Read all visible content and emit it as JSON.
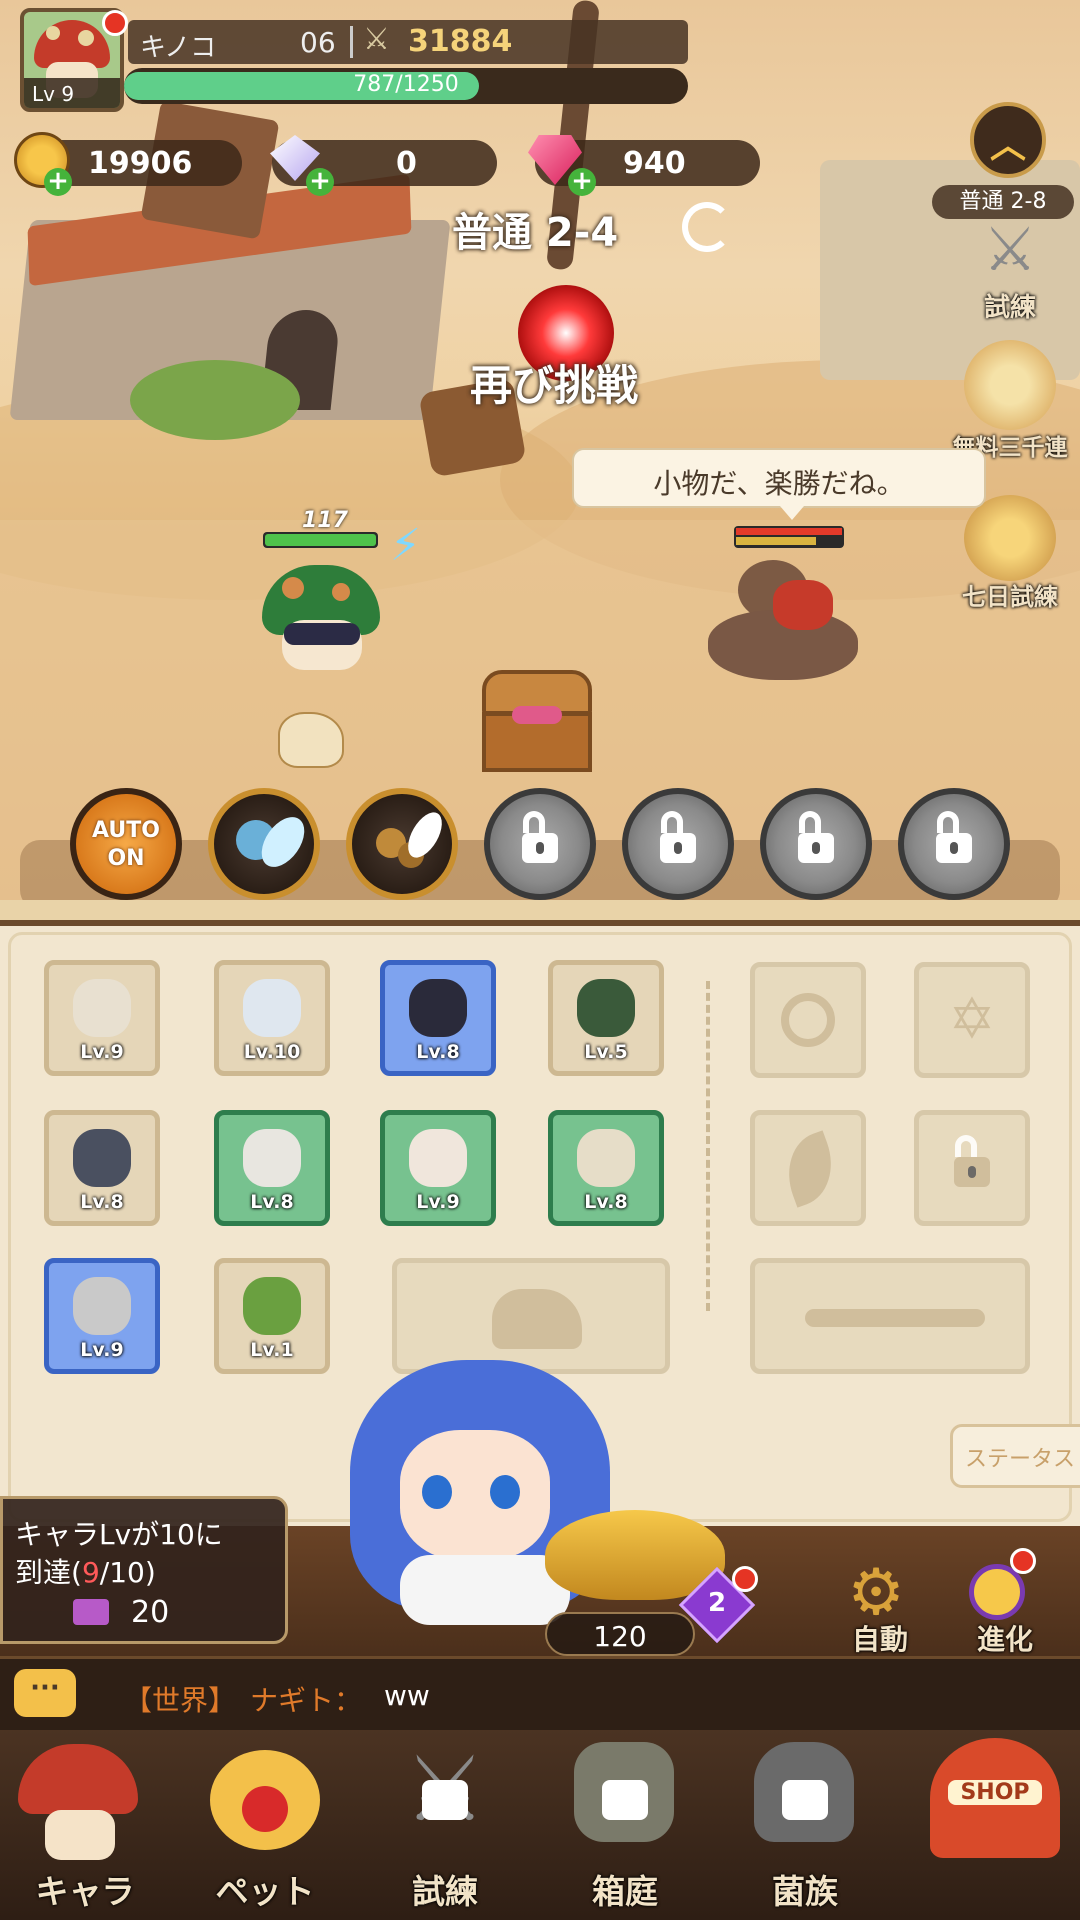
{
  "player": {
    "name": "キノコ",
    "id_suffix": "06",
    "level": "Lv 9",
    "power": "31884",
    "exp_text": "787/1250",
    "exp_progress": 0.63
  },
  "currencies": {
    "gold": "19906",
    "crystal": "0",
    "gem": "940"
  },
  "stage": {
    "label": "普通 2-4",
    "retry_label": "再び挑戦",
    "side_stage": "普通 2-8"
  },
  "side_menu": [
    {
      "label": "試練"
    },
    {
      "label": "無料三千連"
    },
    {
      "label": "七日試練"
    }
  ],
  "battle": {
    "player_hp": "117",
    "enemy_speech": "小物だ、楽勝だね。"
  },
  "skills": {
    "auto_line1": "AUTO",
    "auto_line2": "ON"
  },
  "equipment": [
    {
      "lv": "Lv.9",
      "item": "baseball"
    },
    {
      "lv": "Lv.10",
      "item": "gloves"
    },
    {
      "lv": "Lv.8",
      "item": "goggles"
    },
    {
      "lv": "Lv.5",
      "item": "helmet"
    },
    {
      "lv": "Lv.8",
      "item": "shirt"
    },
    {
      "lv": "Lv.8",
      "item": "boots"
    },
    {
      "lv": "Lv.9",
      "item": "gauntlet"
    },
    {
      "lv": "Lv.8",
      "item": "belt"
    },
    {
      "lv": "Lv.9",
      "item": "shield"
    },
    {
      "lv": "Lv.1",
      "item": "shoes"
    }
  ],
  "status_button": "ステータス",
  "quest": {
    "line1": "キャラLvが10に",
    "line2_prefix": "到達(",
    "line2_progress": "9",
    "line2_suffix": "/10)",
    "reward": "20"
  },
  "lamp": {
    "cost": "120",
    "badge": "2"
  },
  "actions": {
    "auto": "自動",
    "evolve": "進化"
  },
  "chat": {
    "channel": "【世界】",
    "sender": "ナギト：",
    "message": "ww"
  },
  "nav": [
    {
      "label": "キャラ"
    },
    {
      "label": "ペット"
    },
    {
      "label": "試練"
    },
    {
      "label": "箱庭"
    },
    {
      "label": "菌族"
    },
    {
      "label": "SHOP"
    }
  ],
  "colors": {
    "exp_bar": "#5fcf8a",
    "hp_bar": "#4fc24b",
    "wood": "#6b4a2b",
    "panel": "#f2e6cf",
    "gold_text": "#f5d37a"
  }
}
